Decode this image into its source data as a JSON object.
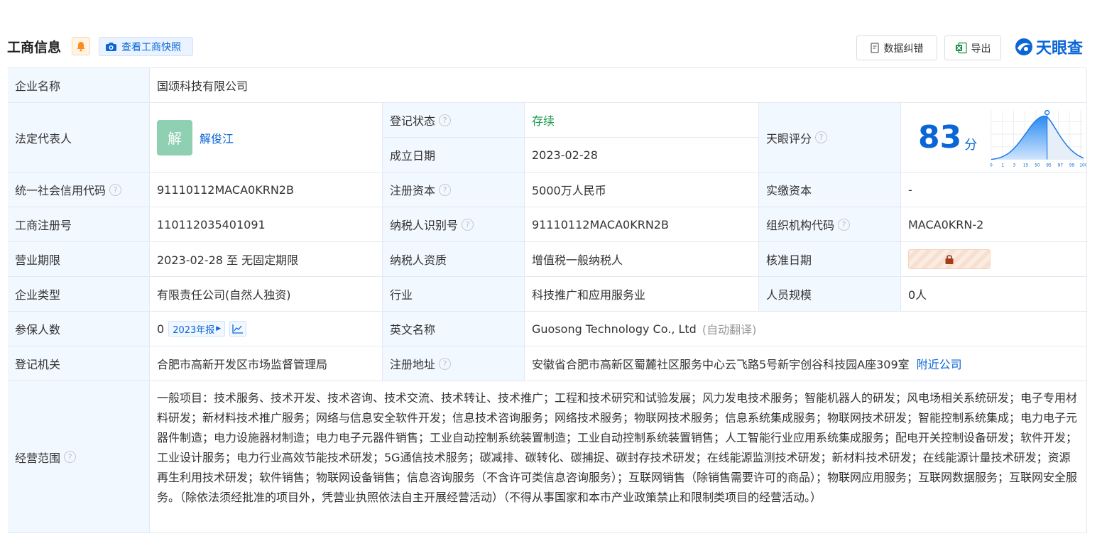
{
  "header": {
    "title": "工商信息",
    "snapshot_label": "查看工商快照",
    "correct_label": "数据纠错",
    "export_label": "导出",
    "logo_text": "天眼查"
  },
  "company": {
    "name_label": "企业名称",
    "name": "国颂科技有限公司",
    "legal_label": "法定代表人",
    "legal_avatar": "解",
    "legal_name": "解俊江",
    "status_label": "登记状态",
    "status": "存续",
    "founded_label": "成立日期",
    "founded": "2023-02-28",
    "score_label": "天眼评分",
    "score": "83",
    "score_unit": "分",
    "score_ticks": [
      "0",
      "1",
      "3",
      "15",
      "50",
      "85",
      "97",
      "99",
      "100"
    ],
    "credit_label": "统一社会信用代码",
    "credit_code": "91110112MACA0KRN2B",
    "reg_capital_label": "注册资本",
    "reg_capital": "5000万人民币",
    "paid_capital_label": "实缴资本",
    "paid_capital": "-",
    "reg_no_label": "工商注册号",
    "reg_no": "110112035401091",
    "taxpayer_id_label": "纳税人识别号",
    "taxpayer_id": "91110112MACA0KRN2B",
    "org_code_label": "组织机构代码",
    "org_code": "MACA0KRN-2",
    "term_label": "营业期限",
    "term": "2023-02-28 至 无固定期限",
    "taxpayer_qual_label": "纳税人资质",
    "taxpayer_qual": "增值税一般纳税人",
    "approve_label": "核准日期",
    "type_label": "企业类型",
    "type": "有限责任公司(自然人独资)",
    "industry_label": "行业",
    "industry": "科技推广和应用服务业",
    "staff_label": "人员规模",
    "staff": "0人",
    "insured_label": "参保人数",
    "insured": "0",
    "report_tag": "2023年报",
    "english_label": "英文名称",
    "english_name": "Guosong Technology Co., Ltd",
    "auto_translate": "(自动翻译)",
    "authority_label": "登记机关",
    "authority": "合肥市高新开发区市场监督管理局",
    "address_label": "注册地址",
    "address": "安徽省合肥市高新区蜀麓社区服务中心云飞路5号新宇创谷科技园A座309室",
    "nearby": "附近公司",
    "scope_label": "经营范围",
    "scope": "一般项目：技术服务、技术开发、技术咨询、技术交流、技术转让、技术推广；工程和技术研究和试验发展；风力发电技术服务；智能机器人的研发；风电场相关系统研发；电子专用材料研发；新材料技术推广服务；网络与信息安全软件开发；信息技术咨询服务；网络技术服务；物联网技术服务；信息系统集成服务；物联网技术研发；智能控制系统集成；电力电子元器件制造；电力设施器材制造；电力电子元器件销售；工业自动控制系统装置制造；工业自动控制系统装置销售；人工智能行业应用系统集成服务；配电开关控制设备研发；软件开发；工业设计服务；电力行业高效节能技术研发；5G通信技术服务；碳减排、碳转化、碳捕捉、碳封存技术研发；在线能源监测技术研发；新材料技术研发；在线能源计量技术研发；资源再生利用技术研发；软件销售；物联网设备销售；信息咨询服务（不含许可类信息咨询服务）；互联网销售（除销售需要许可的商品）；物联网应用服务；互联网数据服务；互联网安全服务。（除依法须经批准的项目外，凭营业执照依法自主开展经营活动）（不得从事国家和本市产业政策禁止和限制类项目的经营活动。）"
  },
  "colors": {
    "accent": "#0a66d6",
    "label_bg": "#f2f8ff",
    "status_green": "#1a9a4c"
  }
}
